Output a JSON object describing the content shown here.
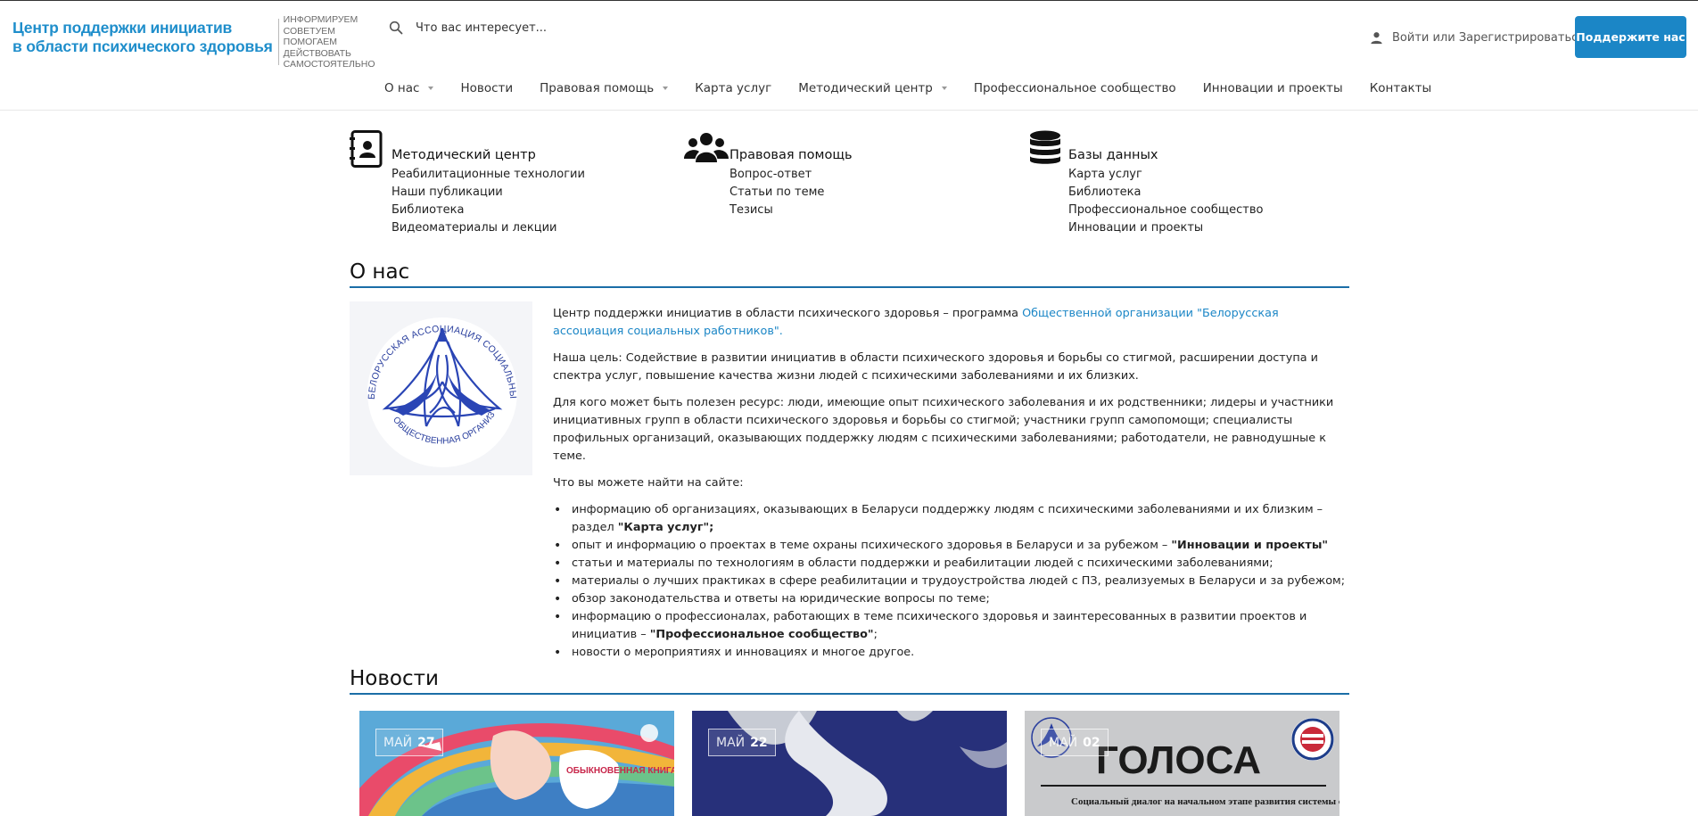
{
  "header": {
    "logo_title_line1": "Центр поддержки инициатив",
    "logo_title_line2": "в области психического здоровья",
    "slogan": [
      "ИНФОРМИРУЕМ",
      "СОВЕТУЕМ",
      "ПОМОГАЕМ",
      "ДЕЙСТВОВАТЬ",
      "САМОСТОЯТЕЛЬНО"
    ],
    "search_placeholder": "Что вас интересует...",
    "login_text": "Войти или Зарегистрироваться",
    "support_button": "Поддержите нас"
  },
  "nav": [
    {
      "label": "О нас",
      "dropdown": true
    },
    {
      "label": "Новости",
      "dropdown": false
    },
    {
      "label": "Правовая помощь",
      "dropdown": true
    },
    {
      "label": "Карта услуг",
      "dropdown": false
    },
    {
      "label": "Методический центр",
      "dropdown": true
    },
    {
      "label": "Профессиональное сообщество",
      "dropdown": false
    },
    {
      "label": "Инновации и проекты",
      "dropdown": false
    },
    {
      "label": "Контакты",
      "dropdown": false
    }
  ],
  "quick_links": [
    {
      "icon": "address-book-icon",
      "title": "Методический центр",
      "links": [
        "Реабилитационные технологии",
        "Наши публикации",
        "Библиотека",
        "Видеоматериалы и лекции"
      ]
    },
    {
      "icon": "users-icon",
      "title": "Правовая помощь",
      "links": [
        "Вопрос-ответ",
        "Статьи по теме",
        "Тезисы"
      ]
    },
    {
      "icon": "database-icon",
      "title": "Базы данных",
      "links": [
        "Карта услуг",
        "Библиотека",
        "Профессиональное сообщество",
        "Инновации и проекты"
      ]
    }
  ],
  "about": {
    "heading": "О нас",
    "logo_ring_top": "БЕЛОРУССКАЯ АССОЦИАЦИЯ СОЦИАЛЬНЫХ РАБОТНИКОВ",
    "logo_ring_bottom": "ОБЩЕСТВЕННАЯ ОРГАНИЗАЦИЯ",
    "p1_text": "Центр поддержки инициатив в области психического здоровья – программа ",
    "p1_link": "Общественной организации \"Белорусская ассоциация социальных работников\".",
    "p2": "Наша цель: Содействие в развитии инициатив в области психического здоровья и борьбы со стигмой, расширении доступа и спектра услуг, повышение качества жизни людей с психическими заболеваниями и их близких.",
    "p3": "Для кого может быть полезен ресурс:  люди, имеющие опыт психического заболевания и их родственники; лидеры и участники инициативных групп в области психического здоровья и борьбы со стигмой; участники групп самопомощи; специалисты профильных организаций, оказывающих поддержку людям с психическими заболеваниями; работодатели, не равнодушные к теме.",
    "p4": "Что вы можете найти на сайте:",
    "b1_text": "информацию об организациях, оказывающих в Беларуси поддержку людям с психическими заболеваниями и их близким – раздел ",
    "b1_bold": "\"Карта услуг\";",
    "b2_text": "опыт и информацию о проектах в теме охраны психического здоровья в Беларуси и за рубежом – ",
    "b2_bold": "\"Инновации и проекты\"",
    "b3": "статьи и материалы по технологиям в области поддержки и реабилитации людей с психическими заболеваниями;",
    "b4": "материалы о лучших практиках в сфере реабилитации и трудоустройства людей с ПЗ, реализуемых в Беларуси и за рубежом;",
    "b5": "обзор законодательства и ответы на юридические вопросы по теме;",
    "b6_text": "информацию о профессионалах, работающих в теме психического здоровья и заинтересованных в развитии проектов и инициатив – ",
    "b6_bold": "\"Профессиональное сообщество\"",
    "b6_end": ";",
    "b7": "новости о мероприятиях и инновациях и многое другое."
  },
  "news": {
    "heading": "Новости",
    "cards": [
      {
        "month": "МАЙ",
        "day": "27",
        "cover_text": "ОБЫКНОВЕННАЯ КНИГА ПРО НЕОБЫКНОВЕННОЕ ВСЁ"
      },
      {
        "month": "МАЙ",
        "day": "22",
        "cover_text": ""
      },
      {
        "month": "МАЙ",
        "day": "02",
        "cover_text": "ГОЛОСА",
        "cover_sub": "Социальный диалог на начальном этапе развития системы социальной поддержки людей с психическими"
      }
    ]
  }
}
